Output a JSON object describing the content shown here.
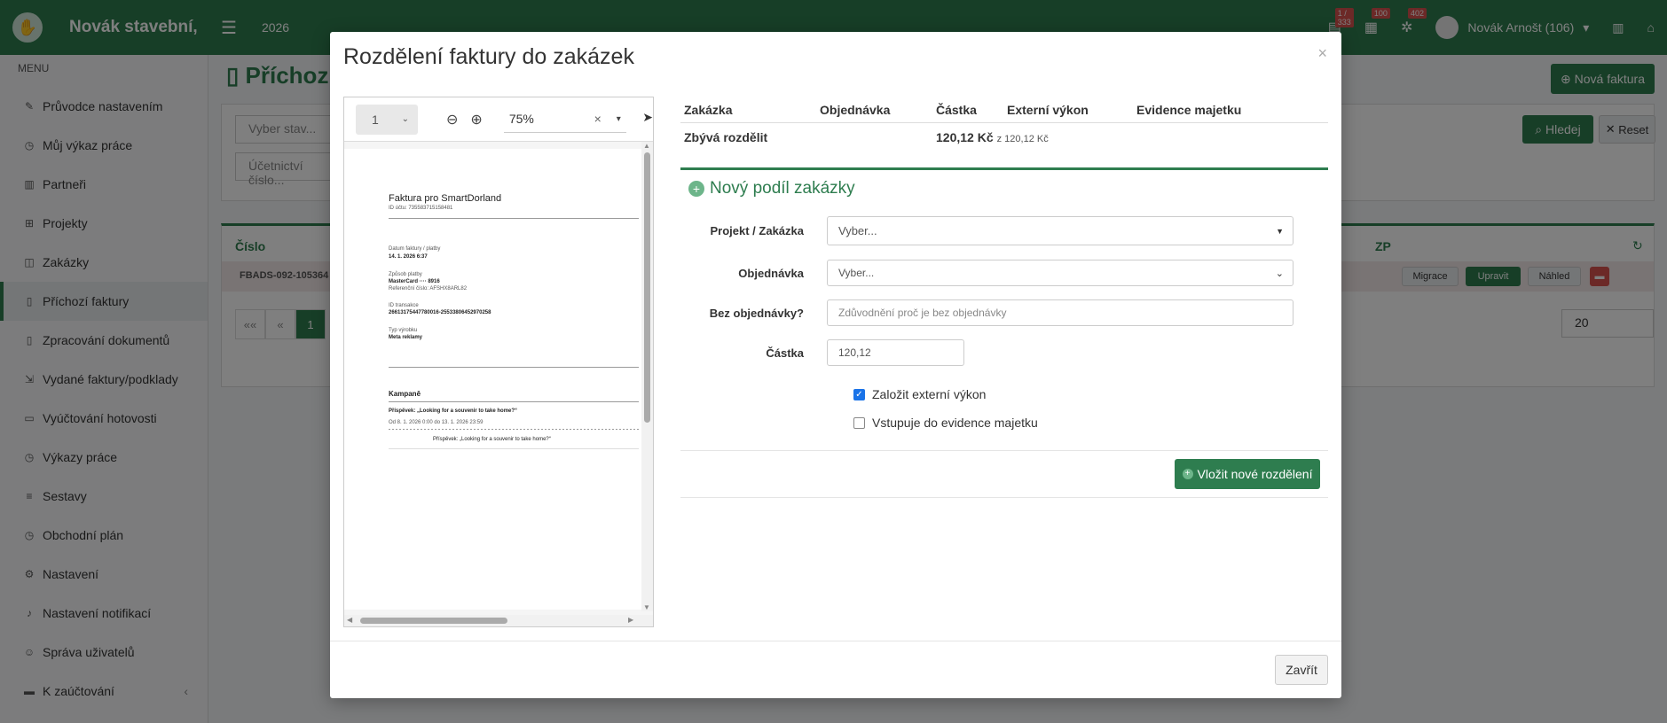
{
  "app": {
    "brand": "Novák stavební,",
    "year": "2026",
    "badges": [
      "1 / 333",
      "100",
      "402"
    ],
    "user": "Novák Arnošt (106)"
  },
  "sidebar": {
    "header": "MENU",
    "items": [
      {
        "label": "Průvodce nastavením",
        "icon": "pencil-icon"
      },
      {
        "label": "Můj výkaz práce",
        "icon": "clock-icon"
      },
      {
        "label": "Partneři",
        "icon": "building-icon"
      },
      {
        "label": "Projekty",
        "icon": "sitemap-icon"
      },
      {
        "label": "Zakázky",
        "icon": "box-icon"
      },
      {
        "label": "Příchozí faktury",
        "icon": "document-icon"
      },
      {
        "label": "Zpracování dokumentů",
        "icon": "document-icon"
      },
      {
        "label": "Vydané faktury/podklady",
        "icon": "export-icon"
      },
      {
        "label": "Vyúčtování hotovosti",
        "icon": "cash-icon"
      },
      {
        "label": "Výkazy práce",
        "icon": "clock-icon"
      },
      {
        "label": "Sestavy",
        "icon": "list-icon"
      },
      {
        "label": "Obchodní plán",
        "icon": "clock-icon"
      },
      {
        "label": "Nastavení",
        "icon": "cogs-icon"
      },
      {
        "label": "Nastavení notifikací",
        "icon": "bell-icon"
      },
      {
        "label": "Správa uživatelů",
        "icon": "users-icon"
      },
      {
        "label": "K zaúčtování",
        "icon": "folder-icon"
      }
    ]
  },
  "page": {
    "title": "Příchoz",
    "new_invoice": "Nová faktura",
    "filter_state": "Vyber stav...",
    "filter_account": "Účetnictví číslo...",
    "search": "Hledej",
    "reset": "Reset",
    "col_number": "Číslo",
    "col_dzp": "ZP",
    "row_number": "FBADS-092-105364",
    "row_actions": [
      "Migrace",
      "Upravit",
      "Náhled"
    ],
    "pager": [
      "««",
      "«",
      "1"
    ],
    "page_size": "20"
  },
  "modal": {
    "title": "Rozdělení faktury do zakázek",
    "close_symbol": "×",
    "pdf": {
      "page": "1",
      "zoom": "75%",
      "doc_title": "Faktura pro SmartDorland",
      "doc_id": "ID účtu: 735583715158481",
      "date_label": "Datum faktury / platby",
      "date_value": "14. 1. 2026 6:37",
      "payment_label": "Způsob platby",
      "payment_value": "MasterCard ···· 8916",
      "ref_label": "Referenční číslo: AFSHX8ARL82",
      "tx_label": "ID transakce",
      "tx_value": "26613175447780016-25533806452970258",
      "product_label": "Typ výrobku",
      "product_value": "Meta reklamy",
      "campaigns": "Kampaně",
      "post": "Příspěvek: „Looking for a souvenir to take home?“",
      "period": "Od 8. 1. 2026 0:00 do 13. 1. 2026 23:59",
      "post_repeat": "Příspěvek: „Looking for a souvenir to take home?“"
    },
    "table": {
      "headers": [
        "Zakázka",
        "Objednávka",
        "Částka",
        "Externí výkon",
        "Evidence majetku"
      ],
      "remaining_label": "Zbývá rozdělit",
      "remaining_amount": "120,12 Kč",
      "remaining_total": "z 120,12 Kč"
    },
    "new_share": {
      "title": "Nový podíl zakázky",
      "project_label": "Projekt / Zakázka",
      "project_value": "Vyber...",
      "order_label": "Objednávka",
      "order_value": "Vyber...",
      "no_order_label": "Bez objednávky?",
      "no_order_placeholder": "Zdůvodnění proč je bez objednávky",
      "amount_label": "Částka",
      "amount_value": "120,12",
      "external_label": "Založit externí výkon",
      "external_checked": true,
      "asset_label": "Vstupuje do evidence majetku",
      "asset_checked": false,
      "insert_button": "Vložit nové rozdělení"
    },
    "close_button": "Zavřít"
  },
  "colors": {
    "brand": "#2e7d4f",
    "checkbox": "#1a73e8"
  }
}
